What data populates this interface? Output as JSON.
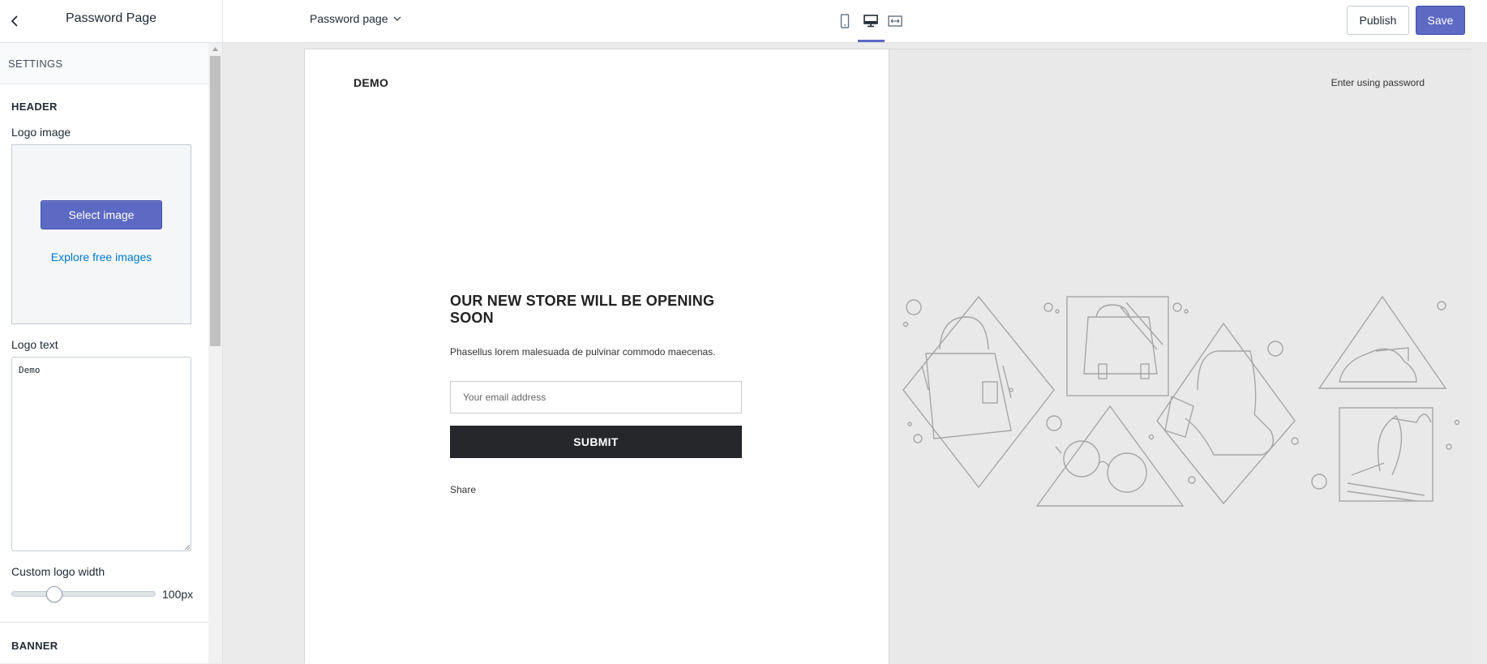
{
  "sidebar": {
    "title": "Password Page",
    "settings_label": "SETTINGS",
    "header_section": "HEADER",
    "logo_image_label": "Logo image",
    "select_image_button": "Select image",
    "explore_link": "Explore free images",
    "logo_text_label": "Logo text",
    "logo_text_value": "Demo",
    "custom_logo_width_label": "Custom logo width",
    "logo_width_value": "100px",
    "logo_width_fraction": 0.27,
    "banner_section": "BANNER"
  },
  "topbar": {
    "page_selector": "Password page",
    "active_device": "desktop",
    "publish_label": "Publish",
    "save_label": "Save",
    "accent_color": "#5c6ac4"
  },
  "preview": {
    "logo": "DEMO",
    "enter_password_link": "Enter using password",
    "heading": "OUR NEW STORE WILL BE OPENING SOON",
    "subtext": "Phasellus lorem malesuada de pulvinar commodo maecenas.",
    "email_placeholder": "Your email address",
    "submit_label": "SUBMIT",
    "share_label": "Share"
  }
}
